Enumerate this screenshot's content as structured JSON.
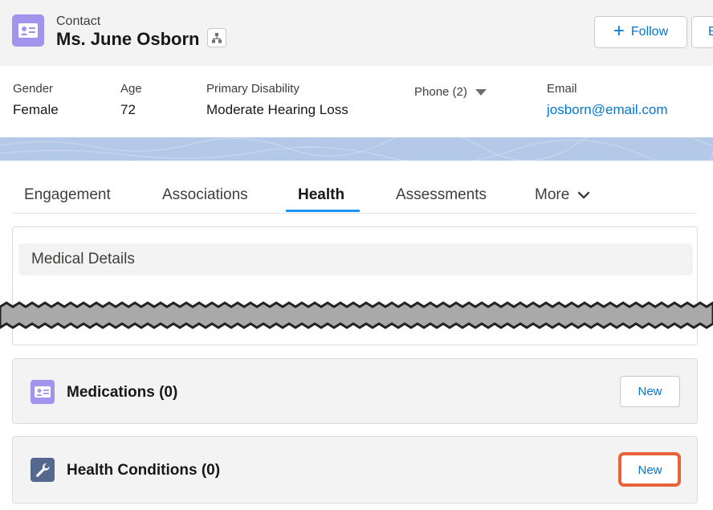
{
  "header": {
    "object_type": "Contact",
    "record_name": "Ms. June Osborn",
    "follow_label": "Follow",
    "edit_label_partial": "E"
  },
  "highlights": {
    "gender": {
      "label": "Gender",
      "value": "Female"
    },
    "age": {
      "label": "Age",
      "value": "72"
    },
    "disability": {
      "label": "Primary Disability",
      "value": "Moderate Hearing Loss"
    },
    "phone": {
      "label": "Phone (2)"
    },
    "email": {
      "label": "Email",
      "value": "josborn@email.com"
    }
  },
  "tabs": {
    "engagement": "Engagement",
    "associations": "Associations",
    "health": "Health",
    "assessments": "Assessments",
    "more": "More",
    "active": "Health"
  },
  "medical_details": {
    "title": "Medical Details"
  },
  "related": {
    "medications": {
      "title": "Medications (0)",
      "new_label": "New"
    },
    "health_conditions": {
      "title": "Health Conditions (0)",
      "new_label": "New"
    }
  },
  "colors": {
    "brand_blue": "#0176d3",
    "contact_icon": "#a094ed",
    "wrench_icon": "#54698d",
    "highlight_box": "#e8623a",
    "tab_underline": "#1b96ff"
  }
}
